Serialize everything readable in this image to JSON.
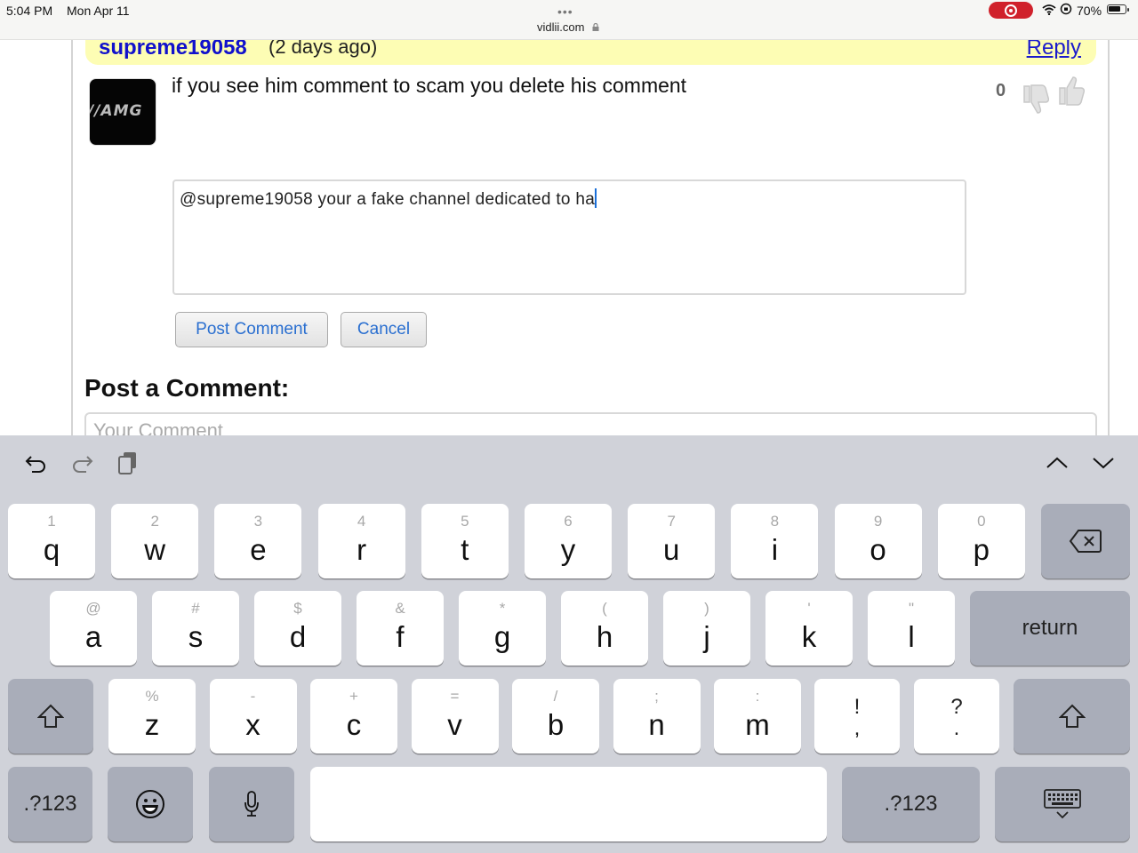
{
  "status_bar": {
    "time": "5:04 PM",
    "date": "Mon Apr 11",
    "url": "vidlii.com",
    "battery_percent": "70%",
    "battery_level": 0.7,
    "recording_color": "#d0212b"
  },
  "comment": {
    "username": "supreme19058",
    "timestamp": "(2 days ago)",
    "reply_label": "Reply",
    "avatar_text": "//AMG",
    "text": "if you see him comment to scam you delete his comment",
    "vote_count": "0",
    "username_color": "#1111cc",
    "header_bg": "#fdfdb4"
  },
  "reply_form": {
    "value": "@supreme19058 your a fake channel dedicated to ha",
    "post_label": "Post Comment",
    "cancel_label": "Cancel"
  },
  "post_section": {
    "title": "Post a Comment:",
    "placeholder": "Your Comment"
  },
  "keyboard": {
    "row1": [
      {
        "alt": "1",
        "key": "q"
      },
      {
        "alt": "2",
        "key": "w"
      },
      {
        "alt": "3",
        "key": "e"
      },
      {
        "alt": "4",
        "key": "r"
      },
      {
        "alt": "5",
        "key": "t"
      },
      {
        "alt": "6",
        "key": "y"
      },
      {
        "alt": "7",
        "key": "u"
      },
      {
        "alt": "8",
        "key": "i"
      },
      {
        "alt": "9",
        "key": "o"
      },
      {
        "alt": "0",
        "key": "p"
      }
    ],
    "row2": [
      {
        "alt": "@",
        "key": "a"
      },
      {
        "alt": "#",
        "key": "s"
      },
      {
        "alt": "$",
        "key": "d"
      },
      {
        "alt": "&",
        "key": "f"
      },
      {
        "alt": "*",
        "key": "g"
      },
      {
        "alt": "(",
        "key": "h"
      },
      {
        "alt": ")",
        "key": "j"
      },
      {
        "alt": "'",
        "key": "k"
      },
      {
        "alt": "\"",
        "key": "l"
      }
    ],
    "row3": [
      {
        "alt": "%",
        "key": "z"
      },
      {
        "alt": "-",
        "key": "x"
      },
      {
        "alt": "+",
        "key": "c"
      },
      {
        "alt": "=",
        "key": "v"
      },
      {
        "alt": "/",
        "key": "b"
      },
      {
        "alt": ";",
        "key": "n"
      },
      {
        "alt": ":",
        "key": "m"
      }
    ],
    "punct": [
      {
        "top": "!",
        "bottom": ","
      },
      {
        "top": "?",
        "bottom": "."
      }
    ],
    "return_label": "return",
    "numbers_label": ".?123"
  }
}
